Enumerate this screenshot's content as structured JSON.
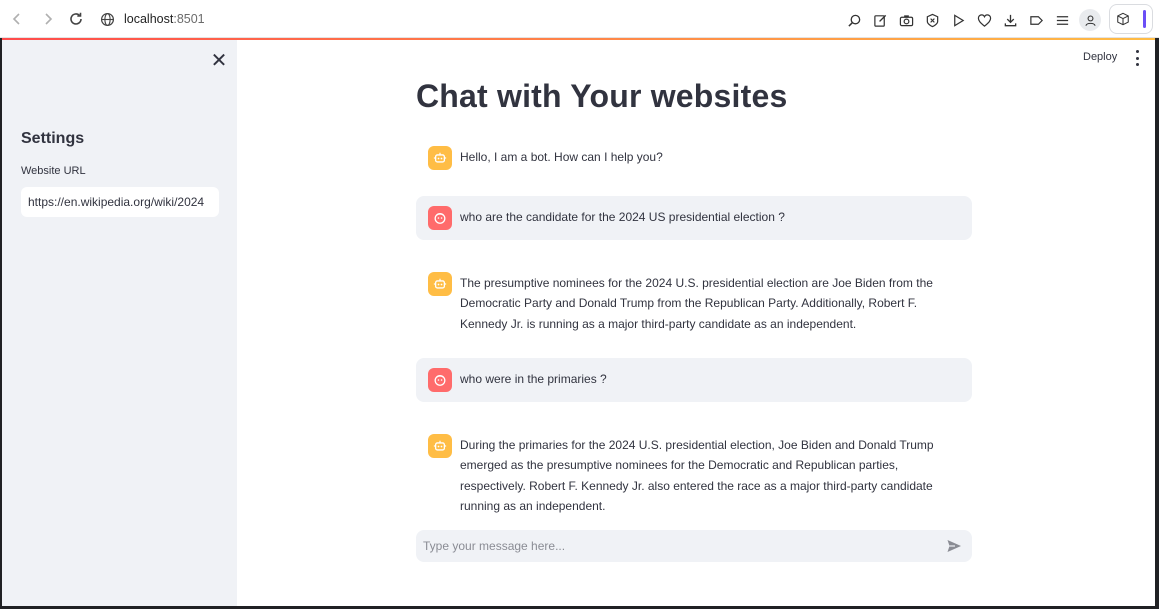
{
  "browser": {
    "url_host": "localhost",
    "url_port": ":8501",
    "icons": [
      "zoom-icon",
      "edit-icon",
      "camera-icon",
      "shield-icon",
      "play-icon",
      "heart-icon",
      "download-icon",
      "tag-icon",
      "menu-icon",
      "profile-icon",
      "extension-icon"
    ]
  },
  "sidebar": {
    "title": "Settings",
    "url_label": "Website URL",
    "url_value": "https://en.wikipedia.org/wiki/2024"
  },
  "header": {
    "deploy_label": "Deploy"
  },
  "main": {
    "title": "Chat with Your websites",
    "messages": [
      {
        "role": "bot",
        "text": "Hello, I am a bot. How can I help you?"
      },
      {
        "role": "user",
        "text": "who are the candidate for the 2024 US presidential election ?"
      },
      {
        "role": "bot",
        "text": "The presumptive nominees for the 2024 U.S. presidential election are Joe Biden from the Democratic Party and Donald Trump from the Republican Party. Additionally, Robert F. Kennedy Jr. is running as a major third-party candidate as an independent."
      },
      {
        "role": "user",
        "text": "who were in the primaries ?"
      },
      {
        "role": "bot",
        "text": "During the primaries for the 2024 U.S. presidential election, Joe Biden and Donald Trump emerged as the presumptive nominees for the Democratic and Republican parties, respectively. Robert F. Kennedy Jr. also entered the race as a major third-party candidate running as an independent."
      }
    ],
    "chat_placeholder": "Type your message here..."
  },
  "colors": {
    "bot_avatar": "#ffbd45",
    "user_avatar": "#ff6b6b",
    "sidebar_bg": "#f0f2f6",
    "accent_bar": "#6b4ef6"
  }
}
